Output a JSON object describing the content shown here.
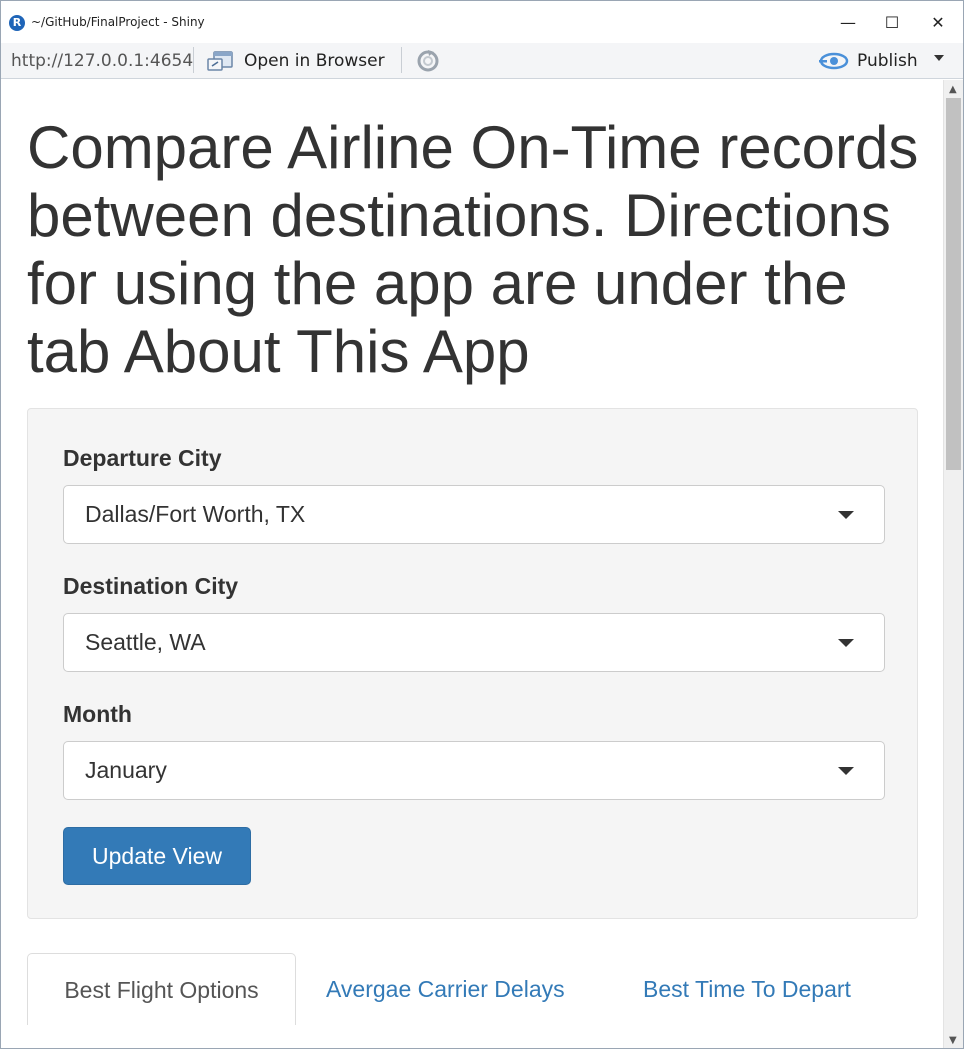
{
  "window": {
    "app_icon_letter": "R",
    "title": "~/GitHub/FinalProject - Shiny",
    "minimize": "—",
    "maximize": "☐",
    "close": "✕"
  },
  "toolbar": {
    "url": "http://127.0.0.1:4654",
    "open_in_browser": "Open in Browser",
    "publish": "Publish"
  },
  "page": {
    "heading": "Compare Airline On-Time records between destinations. Directions for using the app are under the tab About This App"
  },
  "form": {
    "departure_label": "Departure City",
    "departure_value": "Dallas/Fort Worth, TX",
    "destination_label": "Destination City",
    "destination_value": "Seattle, WA",
    "month_label": "Month",
    "month_value": "January",
    "update_button": "Update View"
  },
  "tabs": [
    {
      "label": "Best Flight Options",
      "active": true
    },
    {
      "label": "Avergae Carrier Delays",
      "active": false
    },
    {
      "label": "Best Time To Depart",
      "active": false
    }
  ],
  "colors": {
    "primary": "#337ab7",
    "link": "#337ab7",
    "text": "#333333",
    "well_bg": "#f5f5f5"
  }
}
